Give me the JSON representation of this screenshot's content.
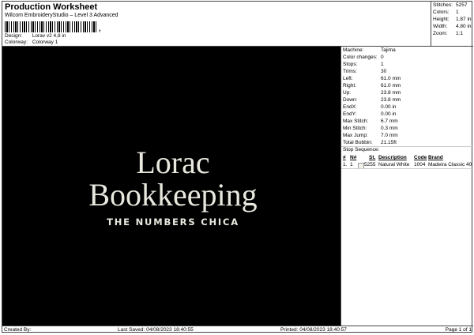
{
  "header": {
    "title": "Production Worksheet",
    "subtitle": "Wilcom EmbroideryStudio – Level 3 Advanced",
    "barcode_mark": ",",
    "design_label": "Design:",
    "design_value": "Lorav v2 4,8 in",
    "colorway_label": "Colorway:",
    "colorway_value": "Colorway 1"
  },
  "summary": [
    {
      "label": "Stitches:",
      "value": "5257"
    },
    {
      "label": "Colors:",
      "value": "1"
    },
    {
      "label": "Height:",
      "value": "1.87 in"
    },
    {
      "label": "Width:",
      "value": "4.80 in"
    },
    {
      "label": "Zoom:",
      "value": "1:1"
    }
  ],
  "design": {
    "line1": "Lorac",
    "line2": "Bookkeeping",
    "line3": "THE NUMBERS CHICA",
    "thread_color": "#e9e8df",
    "background": "#000000"
  },
  "machine_info": [
    {
      "label": "Machine:",
      "value": "Tajima"
    },
    {
      "label": "Color changes:",
      "value": "0"
    },
    {
      "label": "Stops:",
      "value": "1"
    },
    {
      "label": "Trims:",
      "value": "30"
    },
    {
      "label": "Left:",
      "value": "61.0 mm"
    },
    {
      "label": "Right:",
      "value": "61.0 mm"
    },
    {
      "label": "Up:",
      "value": "23.8 mm"
    },
    {
      "label": "Down:",
      "value": "23.8 mm"
    },
    {
      "label": "EndX:",
      "value": "0.00 in"
    },
    {
      "label": "EndY:",
      "value": "0.00 in"
    },
    {
      "label": "Max Stitch:",
      "value": "6.7 mm"
    },
    {
      "label": "Min Stitch:",
      "value": "0.3 mm"
    },
    {
      "label": "Max Jump:",
      "value": "7.0 mm"
    },
    {
      "label": "Total Bobbin:",
      "value": "21.15ft"
    }
  ],
  "stop_sequence": {
    "label": "Stop Sequence:",
    "headers": {
      "num": "#",
      "n": "N#",
      "st": "St.",
      "desc": "Description",
      "code": "Code",
      "brand": "Brand"
    },
    "row": {
      "num": "1.",
      "n": "1",
      "st": "5255",
      "desc": "Natural White",
      "code": "1004",
      "brand": "Madeira Classic 40"
    }
  },
  "footer": {
    "created": "Created By:",
    "saved": "Last Saved: 04/08/2023 18:40:55",
    "printed": "Printed: 04/08/2023 18:40:57",
    "page": "Page 1 of 1"
  }
}
